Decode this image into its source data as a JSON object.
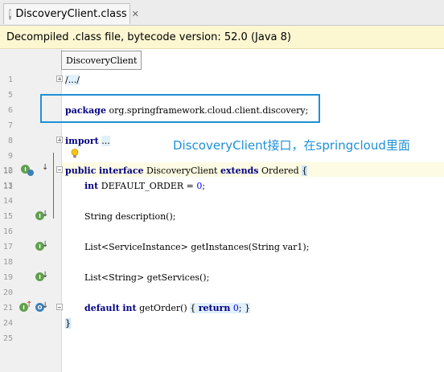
{
  "tab": {
    "title": "DiscoveryClient.class",
    "icon_letter": "I"
  },
  "banner": {
    "text": "Decompiled .class file, bytecode version: 52.0 (Java 8)"
  },
  "tooltip": {
    "text": "DiscoveryClient"
  },
  "annotation": {
    "text": "DiscoveryClient接口，在springcloud里面"
  },
  "lines": [
    {
      "n": "1",
      "text": "/.../"
    },
    {
      "n": "5",
      "text": ""
    },
    {
      "n": "6",
      "text": "package org.springframework.cloud.client.discovery;"
    },
    {
      "n": "7",
      "text": ""
    },
    {
      "n": "8",
      "text": ""
    },
    {
      "n": "9",
      "text": "import ..."
    },
    {
      "n": "10",
      "text": ""
    },
    {
      "n": "11",
      "text": ""
    },
    {
      "n": "12",
      "text": "public interface DiscoveryClient extends Ordered {"
    },
    {
      "n": "13",
      "text": "int DEFAULT_ORDER = 0;"
    },
    {
      "n": "14",
      "text": ""
    },
    {
      "n": "15",
      "text": "String description();"
    },
    {
      "n": "16",
      "text": ""
    },
    {
      "n": "17",
      "text": "List<ServiceInstance> getInstances(String var1);"
    },
    {
      "n": "18",
      "text": ""
    },
    {
      "n": "19",
      "text": "List<String> getServices();"
    },
    {
      "n": "20",
      "text": ""
    },
    {
      "n": "21",
      "text": "default int getOrder() { return 0; }"
    },
    {
      "n": "24",
      "text": "}"
    },
    {
      "n": "25",
      "text": ""
    }
  ],
  "code": {
    "fold1": "/.../",
    "package_kw": "package",
    "package_name": "org.springframework.cloud.client.discovery;",
    "import_kw": "import",
    "import_dots": "...",
    "l12_public": "public",
    "l12_interface": "interface",
    "l12_name": "DiscoveryClient",
    "l12_extends": "extends",
    "l12_parent": "Ordered",
    "l12_brace": "{",
    "l13_int": "int",
    "l13_rest": "DEFAULT_ORDER = ",
    "l13_num": "0",
    "l13_end": ";",
    "l15": "String description();",
    "l17": "List<ServiceInstance> getInstances(String var1);",
    "l19": "List<String> getServices();",
    "l21_default": "default",
    "l21_int": "int",
    "l21_name": "getOrder()",
    "l21_open": "{",
    "l21_return": "return",
    "l21_num": "0",
    "l21_semi": ";",
    "l21_close": "}",
    "l24": "}"
  },
  "gutter_icons": {
    "implemented": "implemented-method-icon",
    "overridden": "overriding-method-icon"
  },
  "colors": {
    "keyword": "#000080",
    "number": "#0000ff",
    "annotation": "#1e90d6",
    "banner_bg": "#fcf6d1"
  }
}
